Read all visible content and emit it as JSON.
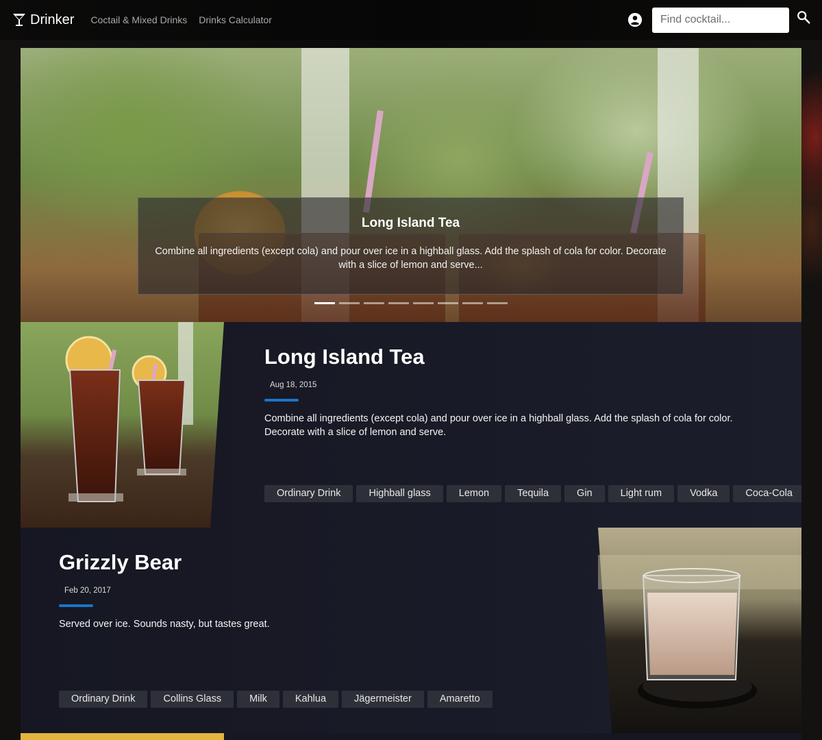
{
  "navbar": {
    "brand": "Drinker",
    "links": [
      "Coctail & Mixed Drinks",
      "Drinks Calculator"
    ],
    "search_placeholder": "Find cocktail...",
    "icons": {
      "brand": "cocktail-glass-icon",
      "account": "account-circle-icon",
      "search": "search-icon"
    }
  },
  "hero": {
    "title": "Long Island Tea",
    "text": "Combine all ingredients (except cola) and pour over ice in a highball glass. Add the splash of cola for color. Decorate with a slice of lemon and serve...",
    "slide_count": 8,
    "active_slide": 1
  },
  "drinks": [
    {
      "title": "Long Island Tea",
      "date": "Aug 18, 2015",
      "description": "Combine all ingredients (except cola) and pour over ice in a highball glass. Add the splash of cola for color. Decorate with a slice of lemon and serve.",
      "tags": [
        "Ordinary Drink",
        "Highball glass",
        "Lemon",
        "Tequila",
        "Gin",
        "Light rum",
        "Vodka",
        "Coca-Cola"
      ]
    },
    {
      "title": "Grizzly Bear",
      "date": "Feb 20, 2017",
      "description": "Served over ice. Sounds nasty, but tastes great.",
      "tags": [
        "Ordinary Drink",
        "Collins Glass",
        "Milk",
        "Kahlua",
        "Jägermeister",
        "Amaretto"
      ]
    }
  ],
  "colors": {
    "accent": "#1b74c8",
    "card_bg": "#1b1d2b",
    "tag_bg": "#2e3039"
  }
}
